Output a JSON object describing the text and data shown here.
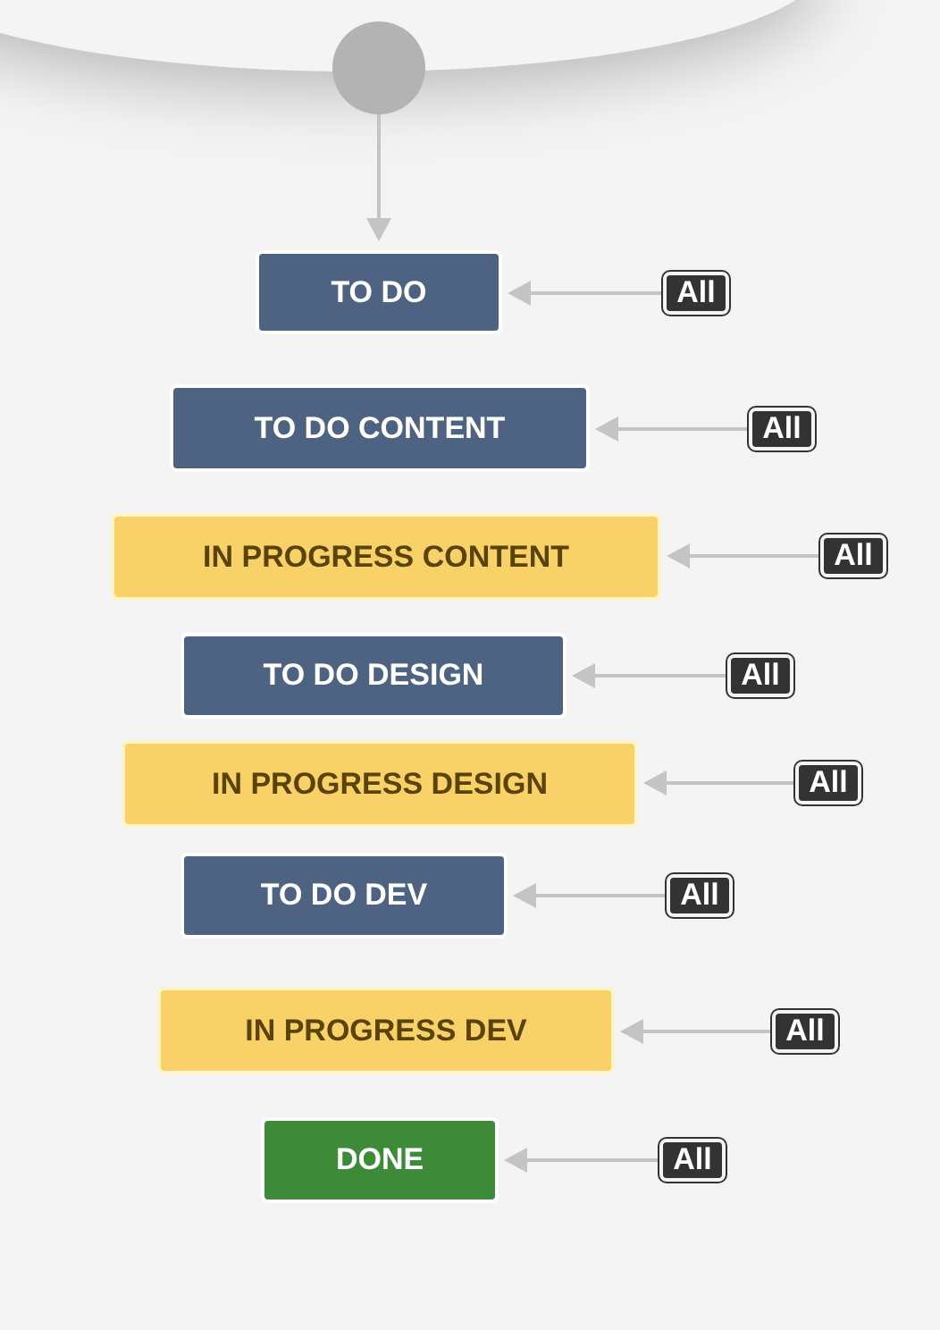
{
  "statuses": [
    {
      "label": "TO DO",
      "kind": "todo",
      "transition": "All"
    },
    {
      "label": "TO DO CONTENT",
      "kind": "todo",
      "transition": "All"
    },
    {
      "label": "IN PROGRESS CONTENT",
      "kind": "inprogress",
      "transition": "All"
    },
    {
      "label": "TO DO DESIGN",
      "kind": "todo",
      "transition": "All"
    },
    {
      "label": "IN PROGRESS DESIGN",
      "kind": "inprogress",
      "transition": "All"
    },
    {
      "label": "TO DO DEV",
      "kind": "todo",
      "transition": "All"
    },
    {
      "label": "IN PROGRESS DEV",
      "kind": "inprogress",
      "transition": "All"
    },
    {
      "label": "DONE",
      "kind": "done",
      "transition": "All"
    }
  ]
}
